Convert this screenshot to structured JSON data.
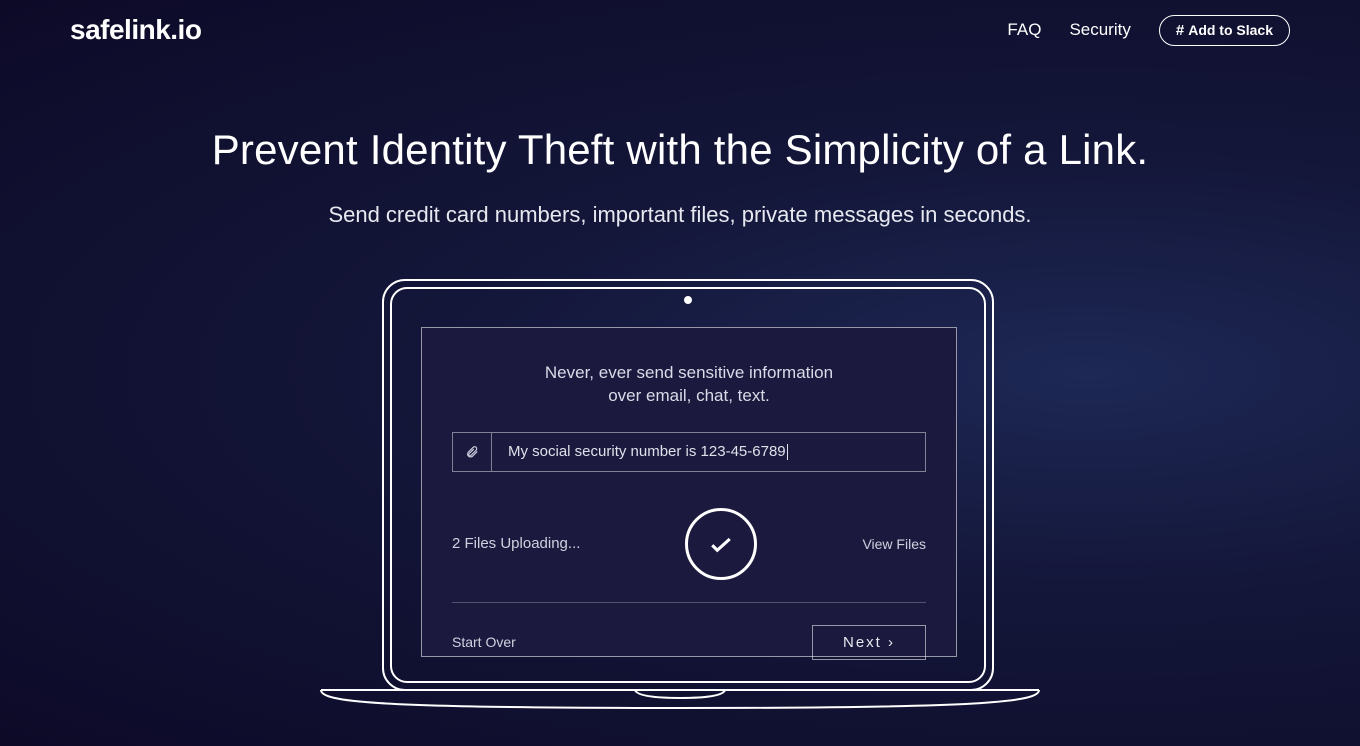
{
  "header": {
    "logo": "safelink.io",
    "nav": {
      "faq": "FAQ",
      "security": "Security",
      "slack": "Add to Slack"
    }
  },
  "hero": {
    "title": "Prevent Identity Theft with the Simplicity of a Link.",
    "subtitle": "Send credit card numbers, important files, private messages in seconds."
  },
  "screen": {
    "title": "Never, ever send sensitive information\nover email, chat, text.",
    "input_value": "My social security number is 123-45-6789",
    "upload_status": "2 Files Uploading...",
    "view_files": "View Files",
    "start_over": "Start Over",
    "next": "Next  ›"
  },
  "icons": {
    "slack": "slack-icon",
    "attach": "paperclip-icon",
    "check": "checkmark-icon"
  }
}
